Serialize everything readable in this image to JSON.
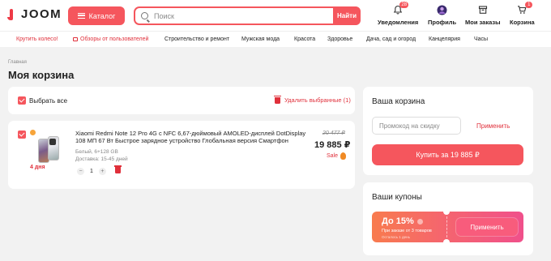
{
  "header": {
    "logo_text": "JOOM",
    "catalog_label": "Каталог",
    "search_placeholder": "Поиск",
    "search_button": "Найти",
    "nav": {
      "notifications": {
        "label": "Уведомления",
        "badge": "28"
      },
      "profile": {
        "label": "Профиль"
      },
      "orders": {
        "label": "Мои заказы"
      },
      "cart": {
        "label": "Корзина",
        "badge": "1"
      }
    }
  },
  "categories": [
    "Крутить колесо!",
    "Обзоры от пользователей",
    "Строительство и ремонт",
    "Мужская мода",
    "Красота",
    "Здоровье",
    "Дача, сад и огород",
    "Канцелярия",
    "Часы"
  ],
  "breadcrumb": "Главная",
  "page_title": "Моя корзина",
  "cart": {
    "select_all_label": "Выбрать все",
    "delete_selected_label": "Удалить выбранные (1)",
    "items": [
      {
        "title": "Xiaomi Redmi Note 12 Pro 4G с NFC 6,67-дюймовый AMOLED-дисплей DotDisplay 108 МП 67 Вт Быстрое зарядное устройство Глобальная версия Смартфон",
        "variant": "Белый, 6+128 GB",
        "delivery": "Доставка: 15-45 дней",
        "delivery_tag": "4 дня",
        "old_price": "20 477 ₽",
        "price": "19 885 ₽",
        "sale_label": "Sale",
        "quantity": "1",
        "qty_minus": "−",
        "qty_plus": "+"
      }
    ]
  },
  "summary": {
    "title": "Ваша корзина",
    "promo_placeholder": "Промокод на скидку",
    "apply_label": "Применить",
    "buy_label": "Купить за 19 885 ₽"
  },
  "coupons": {
    "title": "Ваши купоны",
    "items": [
      {
        "discount": "До 15%",
        "condition": "При заказе от 3 товаров",
        "expiry": "Осталось 1 день",
        "button_label": "Применить"
      }
    ]
  },
  "colors": {
    "accent": "#f5565d",
    "accent_text": "#e0303b",
    "background": "#f2f2f2"
  },
  "icons": {
    "notifications": "bell-icon",
    "profile": "avatar-icon",
    "orders": "box-icon",
    "cart": "cart-icon",
    "delete": "trash-icon",
    "catalog": "menu-icon",
    "search": "search-icon"
  }
}
